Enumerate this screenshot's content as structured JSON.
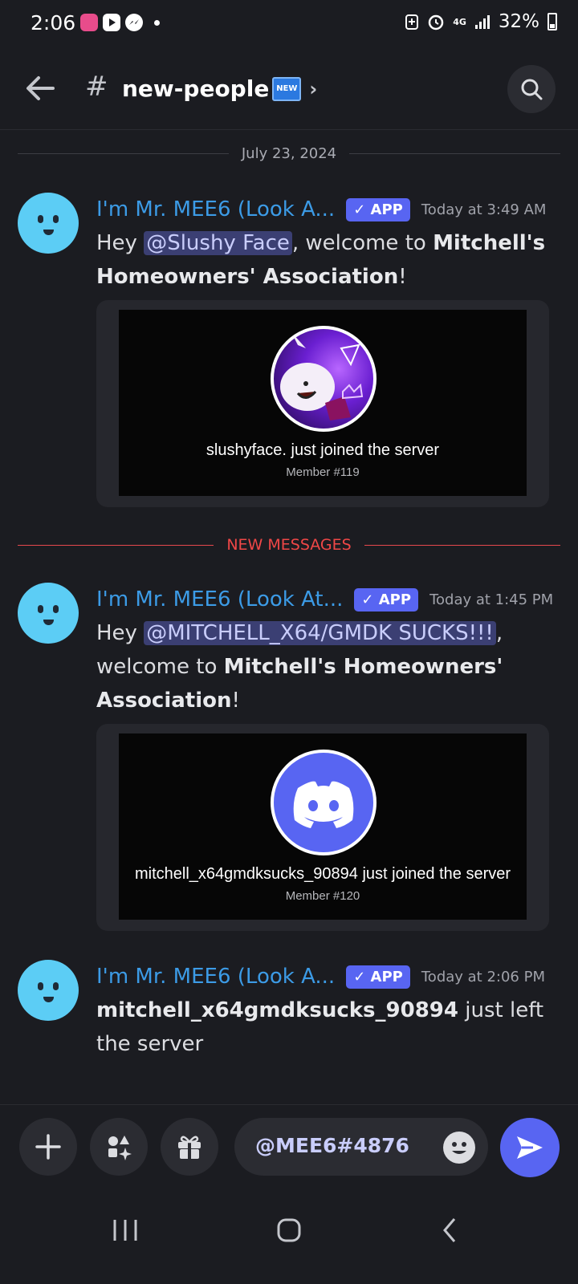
{
  "status_bar": {
    "time": "2:06",
    "network": "4G",
    "battery": "32%"
  },
  "header": {
    "hash": "#",
    "channel": "new-people",
    "channel_badge": "NEW"
  },
  "date_divider": "July 23, 2024",
  "new_messages_divider": "NEW MESSAGES",
  "messages": [
    {
      "author": "I'm Mr. MEE6 (Look A...",
      "badge": "✓ APP",
      "timestamp": "Today at 3:49 AM",
      "text_pre": "Hey ",
      "mention": "@Slushy Face",
      "text_mid": ", welcome to ",
      "server": "Mitchell's Homeowners' Association",
      "text_post": "!",
      "card": {
        "joined": "slushyface. just joined the server",
        "member": "Member #119"
      }
    },
    {
      "author": "I'm Mr. MEE6 (Look At...",
      "badge": "✓ APP",
      "timestamp": "Today at 1:45 PM",
      "text_pre": "Hey ",
      "mention": "@MITCHELL_X64/GMDK SUCKS!!!",
      "text_mid": ", welcome to ",
      "server": "Mitchell's Homeowners' Association",
      "text_post": "!",
      "card": {
        "joined": "mitchell_x64gmdksucks_90894 just joined the server",
        "member": "Member #120"
      }
    },
    {
      "author": "I'm Mr. MEE6 (Look A...",
      "badge": "✓ APP",
      "timestamp": "Today at 2:06 PM",
      "user": "mitchell_x64gmdksucks_90894",
      "text_post": " just left the server"
    }
  ],
  "composer": {
    "value": "@MEE6#4876"
  },
  "colors": {
    "background": "#1b1c21",
    "author": "#3c9be6",
    "badge": "#5865f2",
    "new_messages": "#f04747",
    "avatar": "#5ccdf5"
  }
}
